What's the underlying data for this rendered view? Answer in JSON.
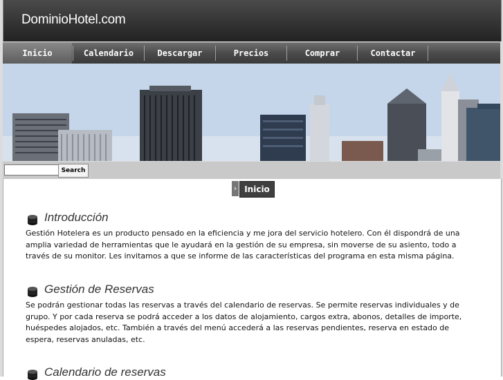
{
  "header": {
    "logo": "DominioHotel.com"
  },
  "nav": {
    "items": [
      {
        "label": "Inicio"
      },
      {
        "label": "Calendario"
      },
      {
        "label": "Descargar"
      },
      {
        "label": "Precios"
      },
      {
        "label": "Comprar"
      },
      {
        "label": "Contactar"
      }
    ],
    "active_index": 0
  },
  "search": {
    "value": "",
    "placeholder": "",
    "button_label": "Search"
  },
  "breadcrumb": {
    "label": "Inicio",
    "arrow_icon": "chevron-right-icon"
  },
  "sections": [
    {
      "title": "Introducción",
      "icon": "cylinder-bullet-icon",
      "body": "Gestión Hotelera es un producto pensado en la eficiencia y me jora del servicio hotelero. Con él dispondrá de una amplia variedad de herramientas que le ayudará en la gestión de su empresa, sin moverse de su asiento, todo a través de su monitor. Les invitamos a que se informe de las características del programa en esta misma página."
    },
    {
      "title": "Gestión de Reservas",
      "icon": "cylinder-bullet-icon",
      "body": "Se podrán gestionar todas las reservas a través del calendario de reservas. Se permite reservas individuales y de grupo. Y por cada reserva se podrá acceder a los datos de alojamiento, cargos extra, abonos, detalles de importe, huéspedes alojados, etc. También a través del menú accederá a las reservas pendientes, reserva en estado de espera, reservas anuladas, etc."
    },
    {
      "title": "Calendario de reservas",
      "icon": "cylinder-bullet-icon",
      "body": ""
    }
  ],
  "colors": {
    "header_dark": "#222222",
    "nav_gray": "#4b4b4b",
    "sky": "#c8d7ea"
  }
}
